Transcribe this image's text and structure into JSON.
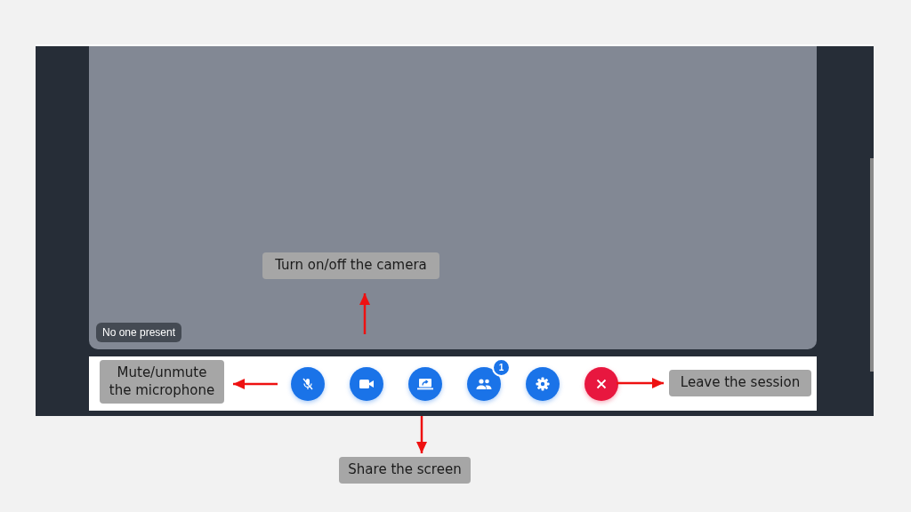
{
  "video": {
    "status_label": "No one present"
  },
  "toolbar": {
    "buttons": [
      {
        "kind": "microphone",
        "muted": true
      },
      {
        "kind": "camera"
      },
      {
        "kind": "share"
      },
      {
        "kind": "participants",
        "badge": "1"
      },
      {
        "kind": "settings"
      },
      {
        "kind": "leave"
      }
    ]
  },
  "annotations": [
    {
      "text": "Turn on/off the camera",
      "kind": "up"
    },
    {
      "text": "Mute/unmute the microphone",
      "kind": "left"
    },
    {
      "text": "Leave the session",
      "kind": "right"
    },
    {
      "text": "Share the screen",
      "kind": "down"
    }
  ]
}
